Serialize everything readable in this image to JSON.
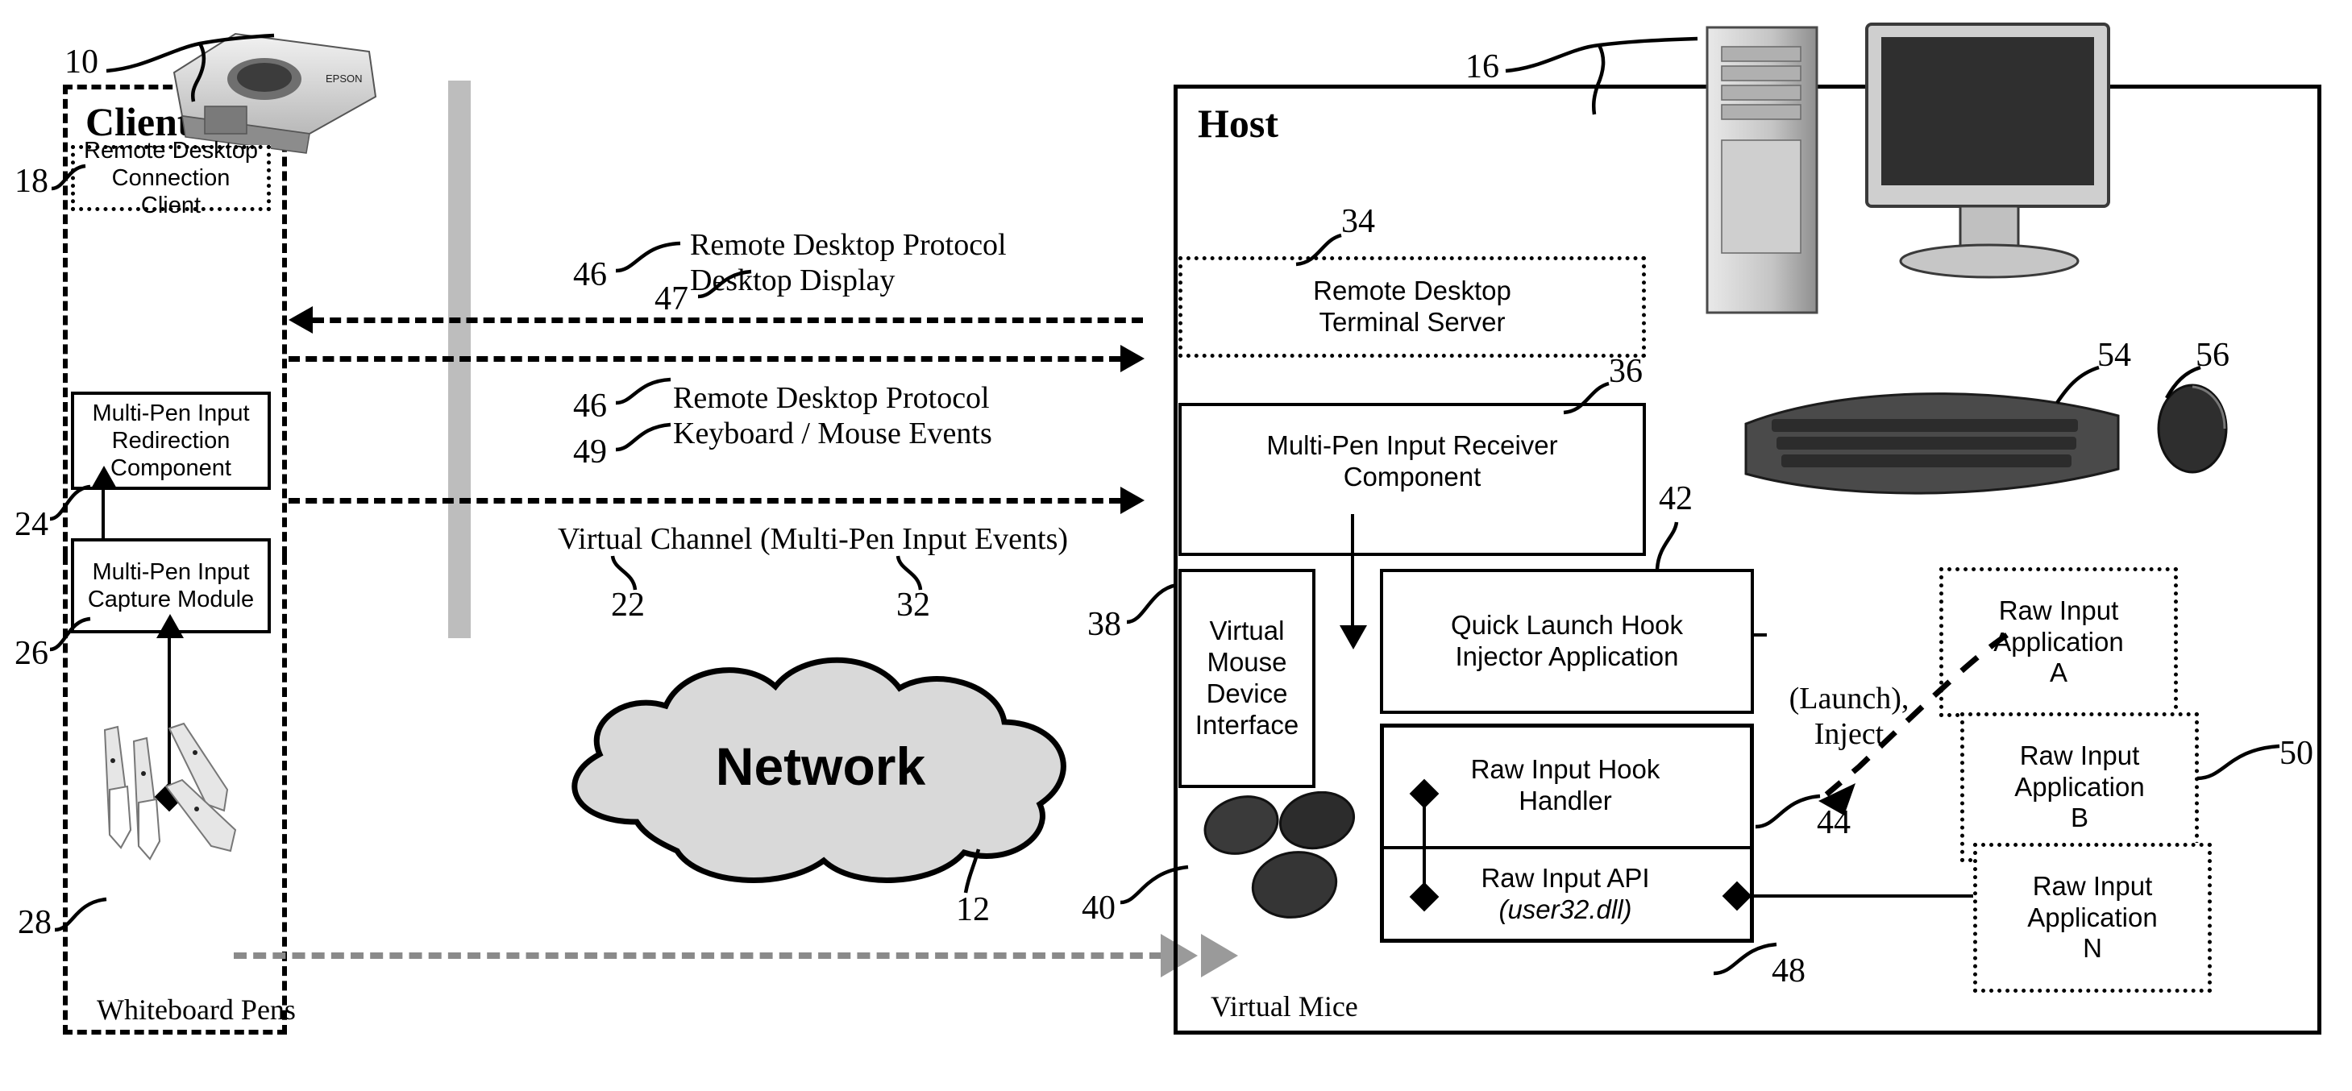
{
  "figure": {
    "client_title": "Client",
    "host_title": "Host",
    "network_label": "Network"
  },
  "client": {
    "boxes": [
      {
        "ref": "18",
        "lines": [
          "Remote Desktop",
          "Connection Client"
        ],
        "style": "dotted"
      },
      {
        "ref": "24",
        "lines": [
          "Multi-Pen Input",
          "Redirection",
          "Component"
        ],
        "style": "solid"
      },
      {
        "ref": "26",
        "lines": [
          "Multi-Pen Input",
          "Capture Module"
        ],
        "style": "solid"
      }
    ],
    "pens_caption": "Whiteboard Pens",
    "pens_ref": "28",
    "projector_ref": "10"
  },
  "host": {
    "boxes": [
      {
        "ref": "34",
        "lines": [
          "Remote Desktop",
          "Terminal Server"
        ],
        "style": "dotted"
      },
      {
        "ref": "36",
        "lines": [
          "Multi-Pen Input Receiver",
          "Component"
        ],
        "style": "solid"
      },
      {
        "ref": "38",
        "lines": [
          "Virtual",
          "Mouse",
          "Device",
          "Interface"
        ],
        "style": "solid"
      },
      {
        "ref": "42",
        "lines": [
          "Quick Launch Hook",
          "Injector Application"
        ],
        "style": "solid"
      },
      {
        "ref": "",
        "lines": [
          "Raw Input Hook",
          "Handler"
        ],
        "style": "solid"
      },
      {
        "ref": "48",
        "lines": [
          "Raw Input API",
          "(user32.dll)"
        ],
        "style": "solid"
      }
    ],
    "raw_input_api_italic": "(user32.dll)",
    "raw_input_api_title": "Raw Input API",
    "virtual_mice_caption": "Virtual Mice",
    "virtual_mice_ref": "40",
    "host_ref": "16",
    "keyboard_ref": "54",
    "mouse_ref": "56",
    "raw_input_hook_ref": "44",
    "raw_input_api_ref": "48"
  },
  "apps": {
    "group_ref": "50",
    "items": [
      {
        "lines": [
          "Raw Input",
          "Application",
          "A"
        ]
      },
      {
        "lines": [
          "Raw Input",
          "Application",
          "B"
        ]
      },
      {
        "lines": [
          "Raw Input",
          "Application",
          "N"
        ]
      }
    ],
    "launch_label_line1": "(Launch),",
    "launch_label_line2": "Inject"
  },
  "channels": [
    {
      "ref_a": "46",
      "ref_b": "47",
      "line1": "Remote Desktop Protocol",
      "line2": "Desktop Display"
    },
    {
      "ref_a": "46",
      "ref_b": "49",
      "line1": "Remote Desktop Protocol",
      "line2": "Keyboard / Mouse Events"
    }
  ],
  "virtual_channel": {
    "label": "Virtual Channel (Multi-Pen Input Events)",
    "ref_left": "22",
    "ref_right": "32"
  },
  "network": {
    "label": "Network",
    "ref": "12"
  }
}
